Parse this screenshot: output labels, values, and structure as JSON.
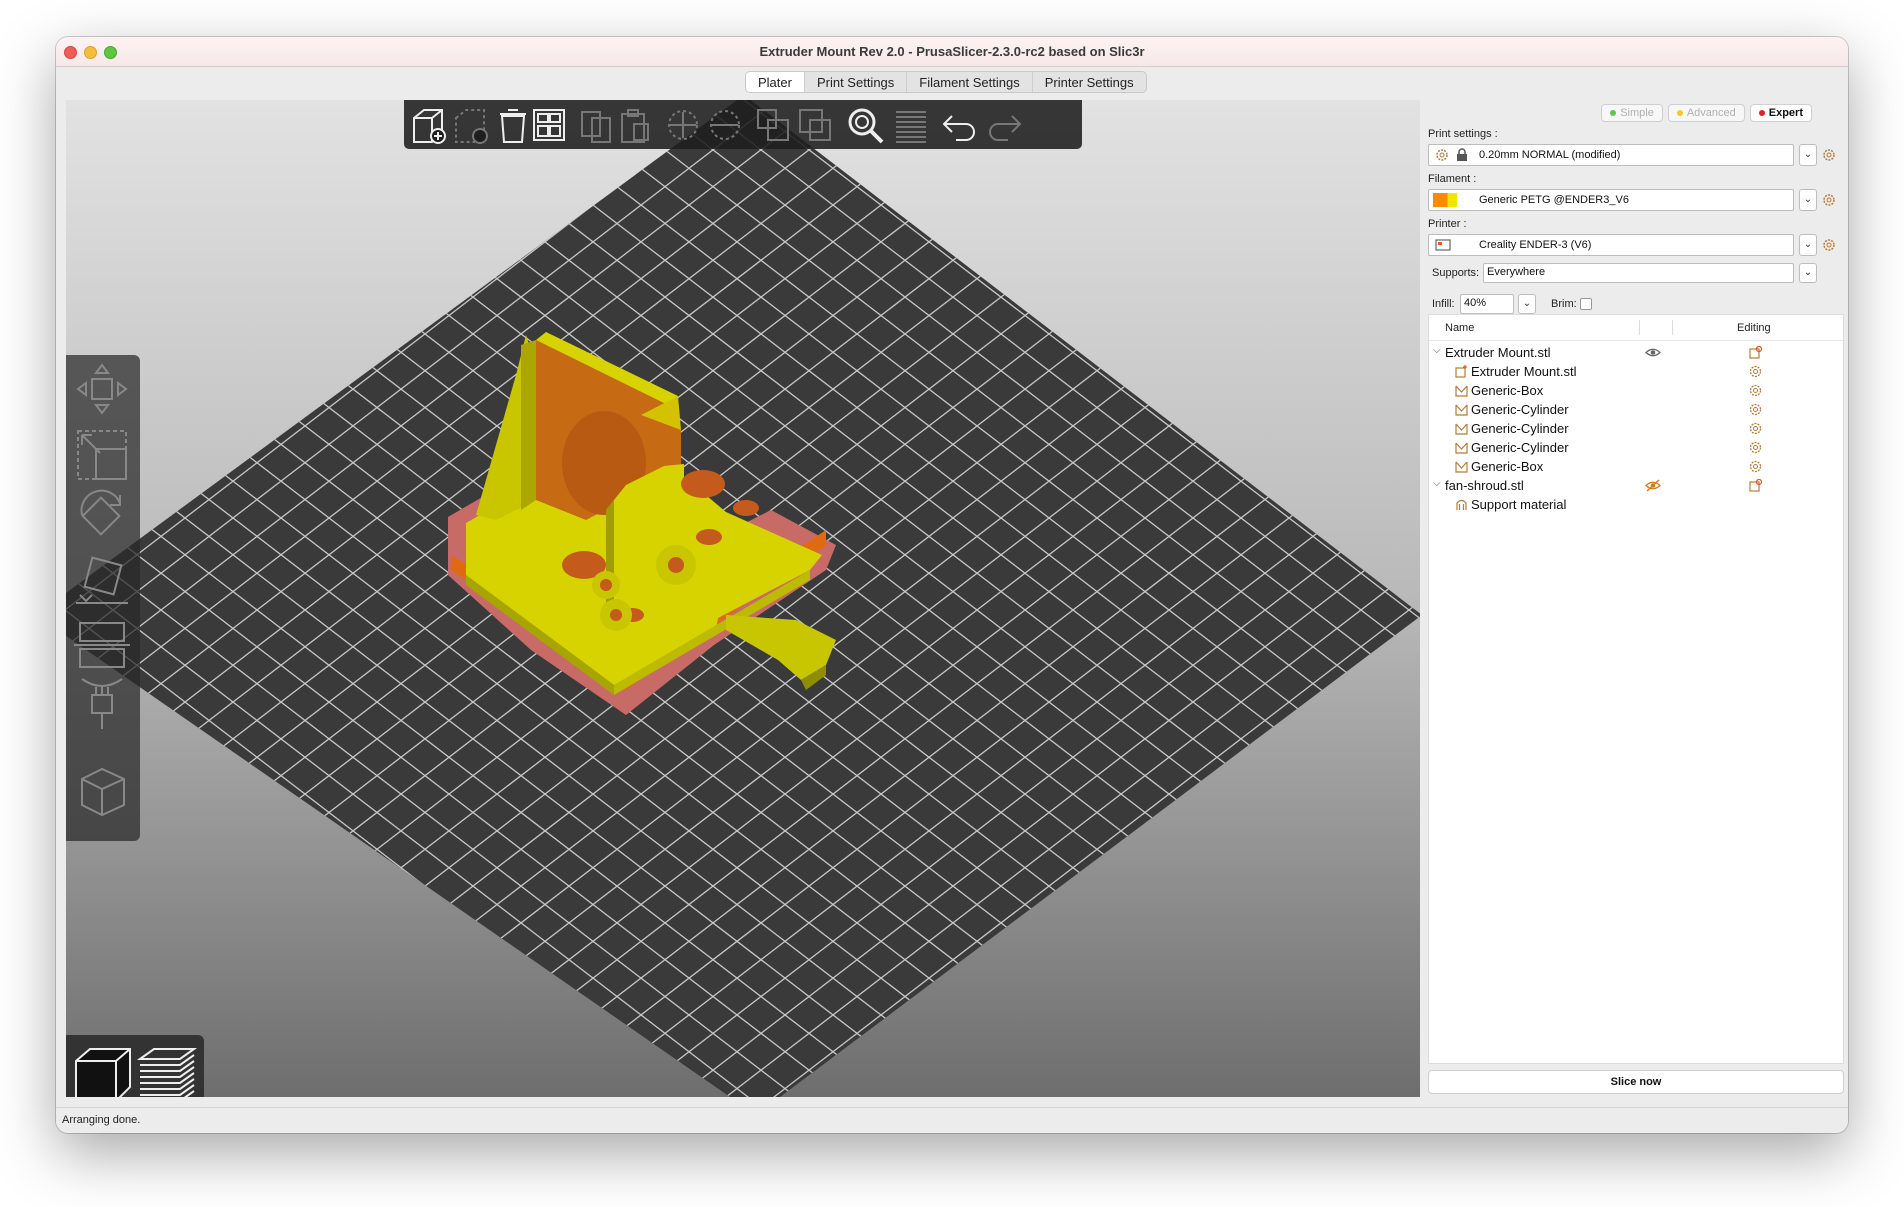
{
  "window": {
    "title": "Extruder Mount Rev 2.0 - PrusaSlicer-2.3.0-rc2 based on Slic3r"
  },
  "tabs": [
    {
      "label": "Plater",
      "active": true
    },
    {
      "label": "Print Settings",
      "active": false
    },
    {
      "label": "Filament Settings",
      "active": false
    },
    {
      "label": "Printer Settings",
      "active": false
    }
  ],
  "toolbar": {
    "icons": [
      "add-icon",
      "delete-icon",
      "delete-all-icon",
      "arrange-icon",
      "copy-icon",
      "paste-icon",
      "add-instance-icon",
      "remove-instance-icon",
      "split-objects-icon",
      "split-parts-icon",
      "search-icon",
      "layers-editing-icon",
      "undo-icon",
      "redo-icon"
    ]
  },
  "gizmos": {
    "icons": [
      "move-icon",
      "scale-icon",
      "rotate-icon",
      "place-on-face-icon",
      "cut-icon",
      "hollow-icon",
      "support-paint-icon",
      "seam-icon"
    ]
  },
  "view_toggle": {
    "icons": [
      "3d-view-icon",
      "preview-icon"
    ]
  },
  "mode": {
    "simple": "Simple",
    "advanced": "Advanced",
    "expert": "Expert",
    "colors": {
      "simple": "#5dc84a",
      "advanced": "#f3cb22",
      "expert": "#e02020"
    }
  },
  "sidebar": {
    "print_settings_label": "Print settings :",
    "print_settings_value": "0.20mm NORMAL (modified)",
    "filament_label": "Filament :",
    "filament_value": "Generic PETG @ENDER3_V6",
    "filament_color": "#ff8a00",
    "printer_label": "Printer :",
    "printer_value": "Creality ENDER-3 (V6)",
    "supports_label": "Supports:",
    "supports_value": "Everywhere",
    "infill_label": "Infill:",
    "infill_value": "40%",
    "brim_label": "Brim:",
    "brim_checked": false
  },
  "object_list": {
    "col_name": "Name",
    "col_editing": "Editing",
    "items": [
      {
        "label": "Extruder Mount.stl",
        "level": 0,
        "expanded": true,
        "icon": "none",
        "visibility": "eye-icon"
      },
      {
        "label": "Extruder Mount.stl",
        "level": 1,
        "icon": "part-icon"
      },
      {
        "label": "Generic-Box",
        "level": 1,
        "icon": "modifier-icon"
      },
      {
        "label": "Generic-Cylinder",
        "level": 1,
        "icon": "modifier-icon"
      },
      {
        "label": "Generic-Cylinder",
        "level": 1,
        "icon": "modifier-icon"
      },
      {
        "label": "Generic-Cylinder",
        "level": 1,
        "icon": "modifier-icon"
      },
      {
        "label": "Generic-Box",
        "level": 1,
        "icon": "modifier-icon"
      },
      {
        "label": "fan-shroud.stl",
        "level": 0,
        "expanded": true,
        "icon": "none",
        "visibility": "eye-hidden-icon"
      },
      {
        "label": "Support material",
        "level": 1,
        "icon": "support-icon"
      }
    ]
  },
  "slice_button": "Slice now",
  "status": "Arranging done.",
  "colors": {
    "bed": "#3a3a3a",
    "model": "#d6d300",
    "model_dark": "#9a9800",
    "highlight_orange": "#d9781a",
    "highlight_pink": "#d8787c"
  }
}
